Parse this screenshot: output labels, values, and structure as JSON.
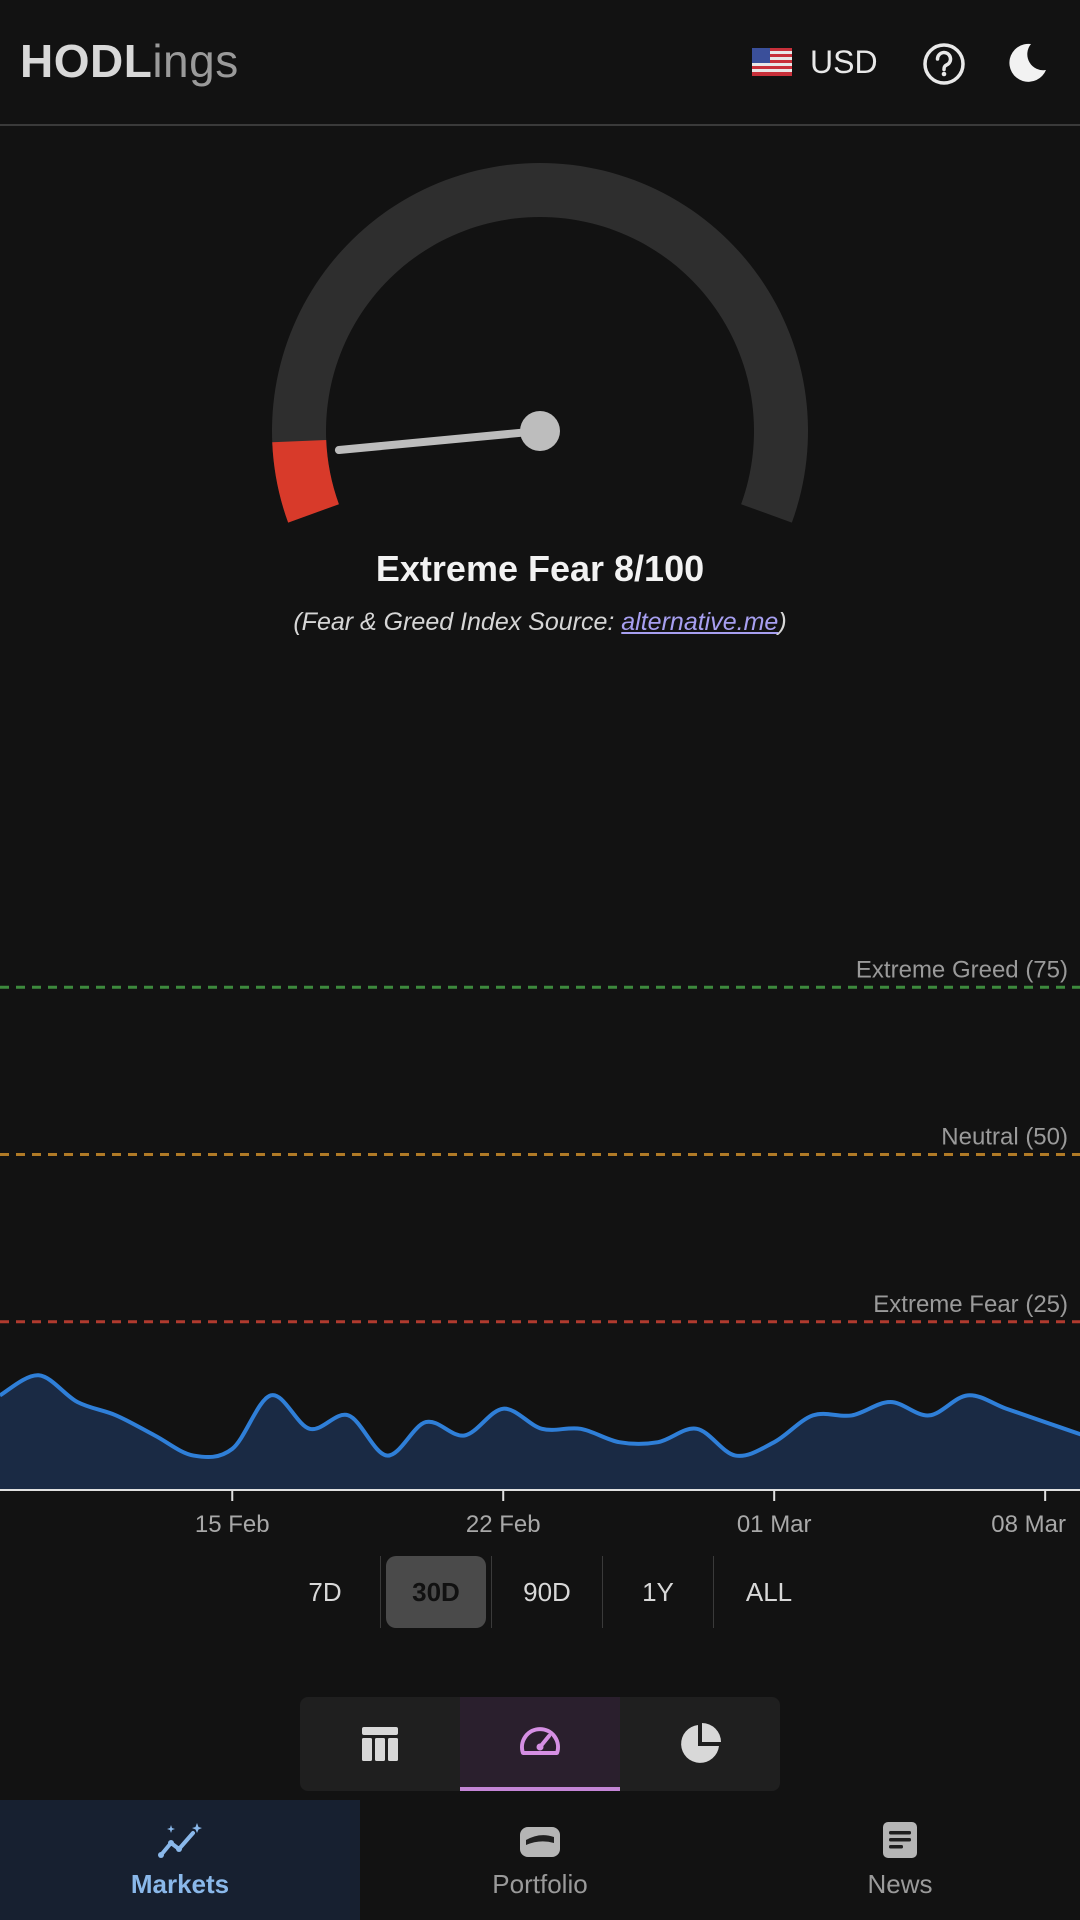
{
  "header": {
    "logo_bold": "HODL",
    "logo_light": "ings",
    "currency_code": "USD",
    "flag_icon": "us-flag-icon",
    "help_icon": "help-circle-icon",
    "theme_icon": "moon-icon"
  },
  "gauge": {
    "label": "Extreme Fear 8/100",
    "value": 8,
    "max": 100,
    "source_prefix": "(Fear & Greed Index Source: ",
    "source_link": "alternative.me",
    "source_suffix": ")",
    "track_color": "#2e2e2e",
    "fill_color": "#d83a2a"
  },
  "chart_data": {
    "type": "area",
    "x_ticks": [
      "15 Feb",
      "22 Feb",
      "01 Mar",
      "08 Mar"
    ],
    "ylim": [
      0,
      100
    ],
    "reference_lines": [
      {
        "label": "Extreme Greed (75)",
        "value": 75,
        "color": "#3d8a3d"
      },
      {
        "label": "Neutral (50)",
        "value": 50,
        "color": "#b07a26"
      },
      {
        "label": "Extreme Fear (25)",
        "value": 25,
        "color": "#b03a2e"
      }
    ],
    "x": [
      "09 Feb",
      "10 Feb",
      "11 Feb",
      "12 Feb",
      "13 Feb",
      "14 Feb",
      "15 Feb",
      "16 Feb",
      "17 Feb",
      "18 Feb",
      "19 Feb",
      "20 Feb",
      "21 Feb",
      "22 Feb",
      "23 Feb",
      "24 Feb",
      "25 Feb",
      "26 Feb",
      "27 Feb",
      "28 Feb",
      "01 Mar",
      "02 Mar",
      "03 Mar",
      "04 Mar",
      "05 Mar",
      "06 Mar",
      "07 Mar",
      "08 Mar",
      "09 Mar"
    ],
    "values": [
      14,
      17,
      13,
      11,
      8,
      5,
      6,
      14,
      9,
      11,
      5,
      10,
      8,
      12,
      9,
      9,
      7,
      7,
      9,
      5,
      7,
      11,
      11,
      13,
      11,
      14,
      12,
      10,
      8
    ],
    "line_color": "#2f7fd8",
    "fill_color": "#1a2a44"
  },
  "ranges": [
    "7D",
    "30D",
    "90D",
    "1Y",
    "ALL"
  ],
  "active_range": "30D",
  "view_switch": [
    "table-icon",
    "gauge-icon",
    "pie-chart-icon"
  ],
  "nav": [
    {
      "label": "Markets",
      "icon": "markets-chart-icon"
    },
    {
      "label": "Portfolio",
      "icon": "wallet-icon"
    },
    {
      "label": "News",
      "icon": "news-icon"
    }
  ]
}
